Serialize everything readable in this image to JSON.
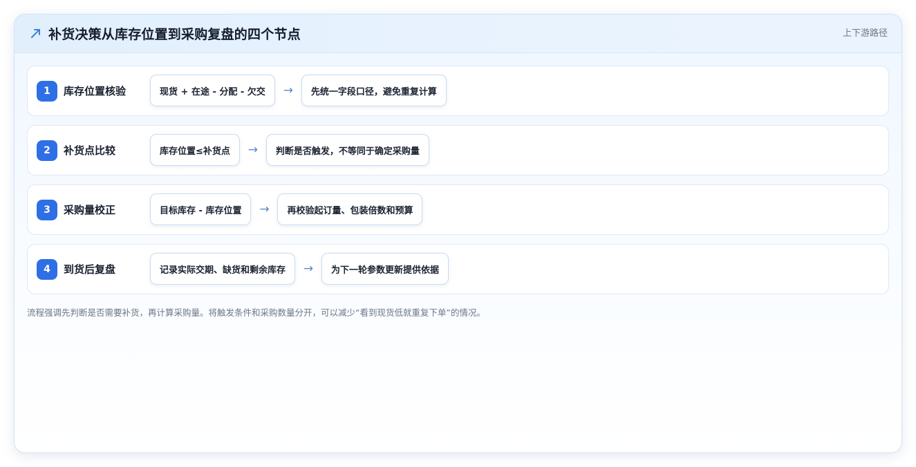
{
  "header": {
    "icon": "trend-up-arrow-icon",
    "title": "补货决策从库存位置到采购复盘的四个节点",
    "tag": "上下游路径"
  },
  "steps": [
    {
      "number": "1",
      "label": "库存位置核验",
      "input": "现货 + 在途 - 分配 - 欠交",
      "output": "先统一字段口径，避免重复计算"
    },
    {
      "number": "2",
      "label": "补货点比较",
      "input": "库存位置≤补货点",
      "output": "判断是否触发，不等同于确定采购量"
    },
    {
      "number": "3",
      "label": "采购量校正",
      "input": "目标库存 - 库存位置",
      "output": "再校验起订量、包装倍数和预算"
    },
    {
      "number": "4",
      "label": "到货后复盘",
      "input": "记录实际交期、缺货和剩余库存",
      "output": "为下一轮参数更新提供依据"
    }
  ],
  "arrow_glyph": "→",
  "note": "流程强调先判断是否需要补货，再计算采购量。将触发条件和采购数量分开，可以减少“看到现货低就重复下单”的情况。",
  "colors": {
    "accent": "#2f6fe6",
    "arrow": "#5d88c8",
    "header_bg": "#e4f0fd",
    "border": "#cfe2f3"
  }
}
